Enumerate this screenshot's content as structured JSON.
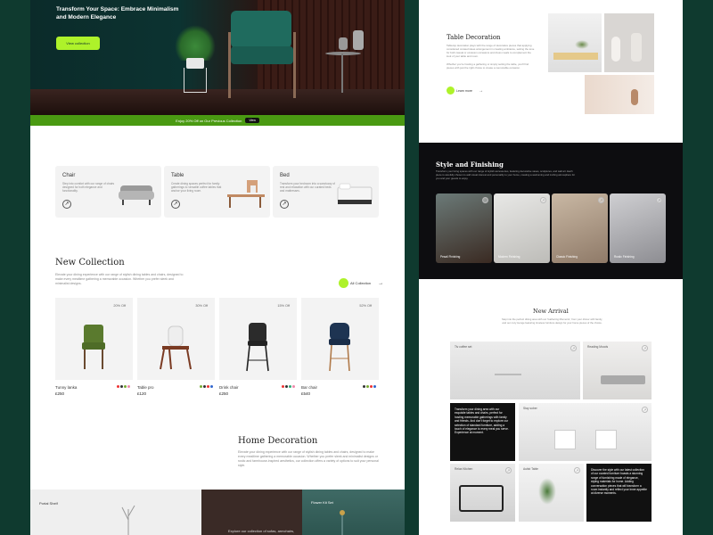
{
  "hero": {
    "title": "Transform Your Space: Embrace Minimalism and Modern Elegance",
    "button": "View collection"
  },
  "promo": {
    "text": "Enjoy 20% Off on Our Previous Collection",
    "button": "View"
  },
  "categories": [
    {
      "title": "Chair",
      "desc": "Step into comfort with our range of chairs designed for both elegance and functionality."
    },
    {
      "title": "Table",
      "desc": "Create dining spaces perfect for family gatherings to versatile coffee tables that anchor your living room."
    },
    {
      "title": "Bed",
      "desc": "Transform your bedroom into a sanctuary of rest and relaxation with our curated beds and mattresses."
    }
  ],
  "new_collection": {
    "title": "New Collection",
    "desc": "Elevate your dining experience with our range of stylish dining tables and chairs, designed to make every mealtime gathering a memorable occasion. Whether you prefer sleek and minimalist designs.",
    "button": "All Collection",
    "products": [
      {
        "name": "Tunny lanka",
        "price": "£250",
        "discount": "20% Off",
        "color": "#5a7a2e",
        "swatches": [
          "#e33",
          "#333",
          "#7a3",
          "#e8a"
        ]
      },
      {
        "name": "Table pro",
        "price": "£120",
        "discount": "30% Off",
        "color": "#eeeeee",
        "swatches": [
          "#7a3",
          "#333",
          "#e33",
          "#36c"
        ]
      },
      {
        "name": "Drink chair",
        "price": "£250",
        "discount": "15% Off",
        "color": "#2b2b2b",
        "swatches": [
          "#e33",
          "#333",
          "#3a7",
          "#e8a"
        ]
      },
      {
        "name": "Bar chair",
        "price": "£540",
        "discount": "52% Off",
        "color": "#1e3452",
        "swatches": [
          "#333",
          "#7a3",
          "#e33",
          "#36c"
        ]
      }
    ]
  },
  "home_decoration": {
    "title": "Home Decoration",
    "desc": "Elevate your dining experience with our range of stylish dining tables and chairs, designed to make every mealtime gathering a memorable occasion. Whether you prefer sleek and minimalist designs or rustic and farmhouse-inspired aesthetics, our collection offers a variety of options to suit your personal style."
  },
  "footer_tiles": [
    {
      "label": "Portal Shelf"
    },
    {
      "label": "Explore our collection of sofas, armchairs,"
    },
    {
      "label": "Flower Kit Set"
    }
  ],
  "table_decoration": {
    "title": "Table Decoration",
    "desc1": "Tabletop decoration plays with the range of decorative pieces that applying considered curated ideas arrangement in creating ambiance, setting the tone for both casual or occasion occasions and dress meals to complement the look of your table and room.",
    "desc2": "Whether you're hosting a gathering or simply setting the table, you'll find pieces with just the right choice to create a memorable occasion.",
    "button": "Learn more"
  },
  "style_finishing": {
    "title": "Style and Finishing",
    "desc": "Transform your living spaces with our range of stylish accessories, featuring decorative vases, sculptures, and wall art. Each piece is carefully chosen to add visual interest and personality to your home, creating a welcoming and inviting atmosphere for you and your guests to enjoy.",
    "cards": [
      {
        "label": "Pesail Finishing",
        "bg": "linear-gradient(160deg,#6b7a78,#3a2a22)"
      },
      {
        "label": "Modern Finishing",
        "bg": "linear-gradient(160deg,#e8e8e6,#bdbcb8)"
      },
      {
        "label": "Classic Finishing",
        "bg": "linear-gradient(160deg,#c9b8a4,#8f7a68)"
      },
      {
        "label": "Rustic Finishing",
        "bg": "linear-gradient(160deg,#cfcfd2,#8d8d92)"
      }
    ]
  },
  "new_arrival": {
    "title": "New Arrival",
    "desc": "Step into the perfect dining area with our 'Gathering Moments', from your dinner with family, and our cozy lounge featuring timeless furniture design for your home pieces of the choice.",
    "tiles": {
      "coffee": "Tiv coffee set",
      "reading": "Reading Moods",
      "stay": "Stay sober",
      "cafe": "Relax Kitchen",
      "window": "Autist Table"
    },
    "card1": "Transform your dining area with our exquisite tables and chairs, perfect for hosting memorable gatherings with family and friends. And don't forget to explore our selection of standard furniture, adding a touch of elegance to every meal you serve. Experience at moment.",
    "card2": "Discover the style with our latest collection of our curated furniture boasts a stunning range of furnishing made of elegance, styling materials for home. Adding conversation pieces that will transform a room instantly and reflect your inner appetite at diverse moments."
  }
}
